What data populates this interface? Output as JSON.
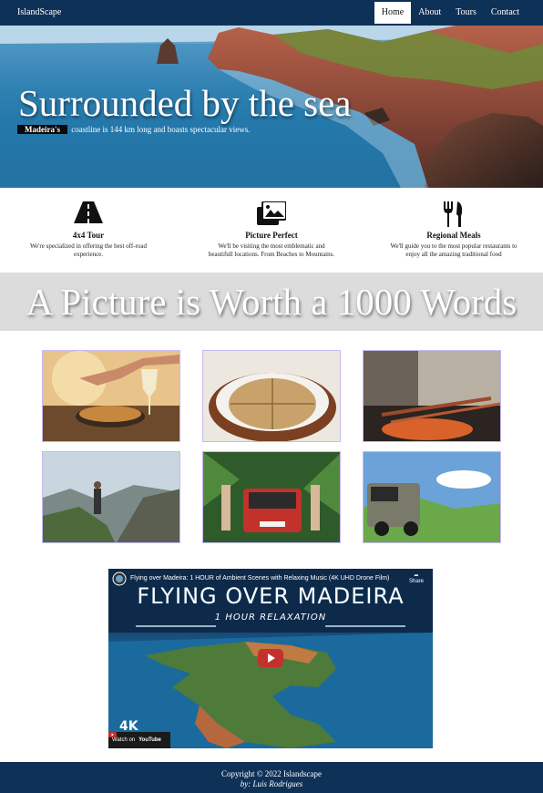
{
  "nav": {
    "brand": "IslandScape",
    "items": [
      {
        "label": "Home",
        "active": true
      },
      {
        "label": "About"
      },
      {
        "label": "Tours"
      },
      {
        "label": "Contact"
      }
    ]
  },
  "hero": {
    "title": "Surrounded by the sea",
    "badge": "Madeira's",
    "subtitle": "coastline is 144 km long and boasts spectacular views."
  },
  "features": [
    {
      "icon": "road-icon",
      "title": "4x4 Tour",
      "text": "We're specialized in offering the best off-road experience."
    },
    {
      "icon": "images-icon",
      "title": "Picture Perfect",
      "text": "We'll be visiting the most emblematic and beautifull locations. From Beaches to Mountains."
    },
    {
      "icon": "utensils-icon",
      "title": "Regional Meals",
      "text": "We'll guide you to the most popular restaurants to enjoy all the amazing traditional food"
    }
  ],
  "banner": {
    "title": "A Picture is Worth a 1000 Words"
  },
  "gallery": [
    {
      "subject": "seafood-dish-with-wine"
    },
    {
      "subject": "bolo-do-caco-bread"
    },
    {
      "subject": "espetada-grill"
    },
    {
      "subject": "hiker-on-mountain"
    },
    {
      "subject": "red-jeep-in-forest"
    },
    {
      "subject": "land-rover-on-ridge"
    }
  ],
  "video": {
    "title": "Flying over Madeira: 1 HOUR of Ambient Scenes with Relaxing Music (4K UHD Drone Film)",
    "share_label": "Share",
    "heading": "FLYING OVER MADEIRA",
    "subheading": "1 HOUR RELAXATION",
    "badge": "4K",
    "watch_on": "Watch on",
    "platform": "YouTube"
  },
  "footer": {
    "copyright": "Copyright © 2022 Islandscape",
    "author": "by: Luis Rodrigues"
  },
  "colors": {
    "nav_bg": "#0e3158",
    "banner_bg": "#dcdcdc",
    "play_red": "#c4302b"
  }
}
